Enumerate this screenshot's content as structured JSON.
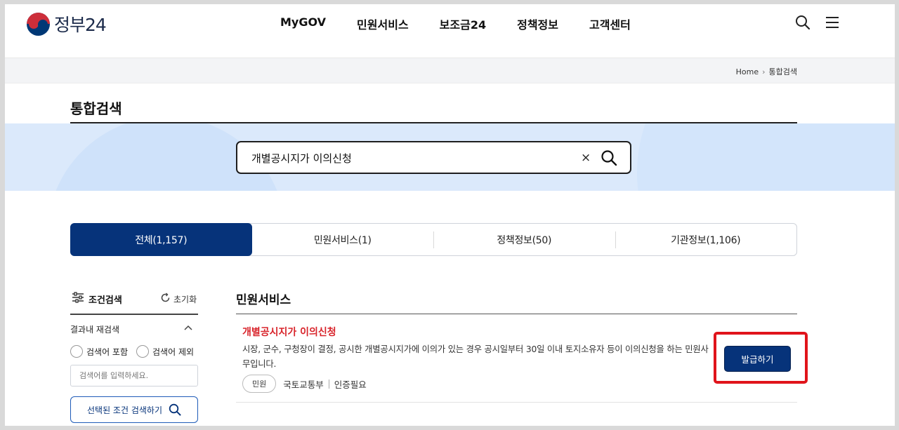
{
  "header": {
    "logo_text": "정부24",
    "nav": [
      "MyGOV",
      "민원서비스",
      "보조금24",
      "정책정보",
      "고객센터"
    ],
    "icons": [
      "search-icon",
      "menu-icon"
    ]
  },
  "breadcrumb": {
    "home": "Home",
    "current": "통합검색"
  },
  "page_title": "통합검색",
  "search": {
    "query": "개별공시지가 이의신청",
    "clear": "×"
  },
  "tabs": [
    {
      "label": "전체(1,157)",
      "active": true
    },
    {
      "label": "민원서비스(1)",
      "active": false
    },
    {
      "label": "정책정보(50)",
      "active": false
    },
    {
      "label": "기관정보(1,106)",
      "active": false
    }
  ],
  "sidebar": {
    "title": "조건검색",
    "reset": "초기화",
    "refine_title": "결과내 재검색",
    "include_label": "검색어 포함",
    "exclude_label": "검색어 제외",
    "input_placeholder": "검색어를 입력하세요.",
    "search_button": "선택된 조건 검색하기"
  },
  "results": {
    "section_title": "민원서비스",
    "items": [
      {
        "title": "개별공시지가 이의신청",
        "description": "시장, 군수, 구청장이 결정, 공시한 개별공시지가에 이의가 있는 경우 공시일부터 30일 이내 토지소유자 등이 이의신청을 하는 민원사무입니다.",
        "category": "민원",
        "agency": "국토교통부",
        "auth": "인증필요",
        "action_button": "발급하기"
      }
    ]
  },
  "colors": {
    "primary": "#06337a",
    "highlight": "#e0141b",
    "result_title": "#d8232a"
  }
}
